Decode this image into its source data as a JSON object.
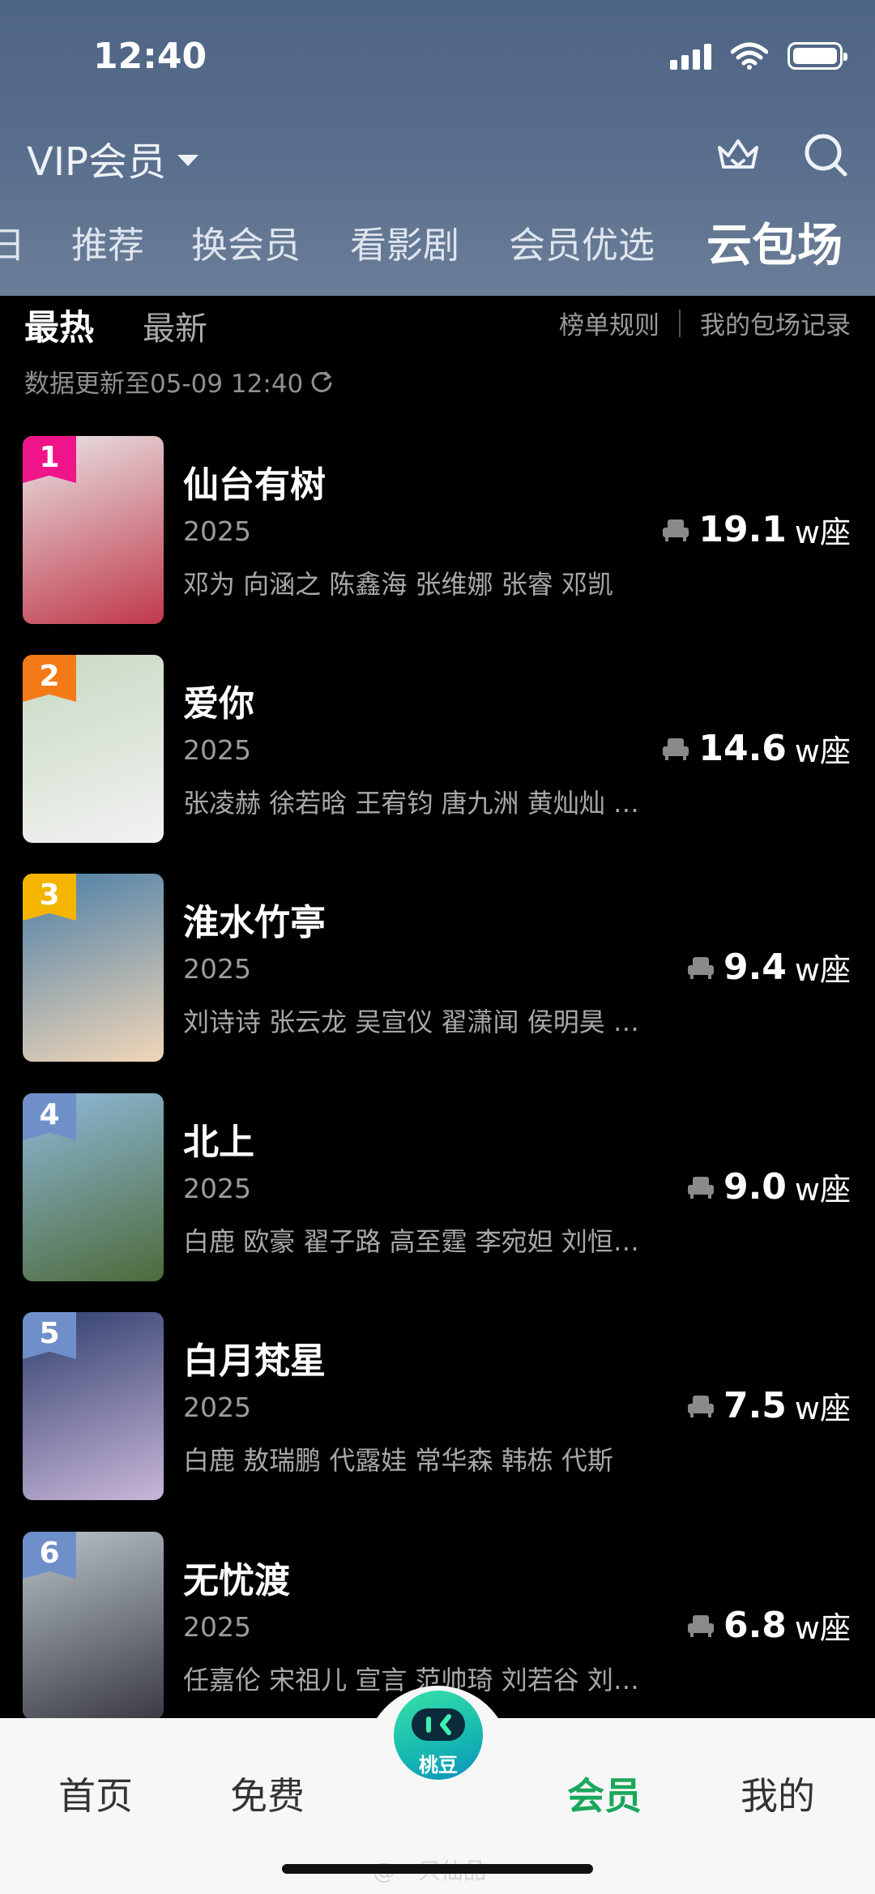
{
  "status_bar": {
    "time": "12:40"
  },
  "header": {
    "vip_selector": "VIP会员",
    "tabs": [
      {
        "label": "日",
        "active": false
      },
      {
        "label": "推荐",
        "active": false
      },
      {
        "label": "换会员",
        "active": false
      },
      {
        "label": "看影剧",
        "active": false
      },
      {
        "label": "会员优选",
        "active": false
      },
      {
        "label": "云包场",
        "active": true
      }
    ]
  },
  "sub_tabs": [
    {
      "label": "最热",
      "active": true
    },
    {
      "label": "最新",
      "active": false
    }
  ],
  "links": {
    "rules": "榜单规则",
    "my_records": "我的包场记录"
  },
  "update_text": "数据更新至05-09 12:40",
  "items": [
    {
      "rank": "1",
      "rank_color": "#f0148a",
      "title": "仙台有树",
      "year": "2025",
      "cast": "邓为 向涵之 陈鑫海 张维娜 张睿 邓凯",
      "seats_value": "19.1",
      "seats_unit": "w座",
      "poster_colors": [
        "#e8e4e6",
        "#c0394a"
      ]
    },
    {
      "rank": "2",
      "rank_color": "#f47a18",
      "title": "爱你",
      "year": "2025",
      "cast": "张凌赫 徐若晗 王宥钧 唐九洲 黄灿灿 …",
      "seats_value": "14.6",
      "seats_unit": "w座",
      "poster_colors": [
        "#c8d9c2",
        "#f2f2f2"
      ]
    },
    {
      "rank": "3",
      "rank_color": "#f5b400",
      "title": "淮水竹亭",
      "year": "2025",
      "cast": "刘诗诗 张云龙 吴宣仪 翟潇闻 侯明昊 …",
      "seats_value": "9.4",
      "seats_unit": "w座",
      "poster_colors": [
        "#4b7fa6",
        "#f1d6b8"
      ]
    },
    {
      "rank": "4",
      "rank_color": "#6f8fc9",
      "title": "北上",
      "year": "2025",
      "cast": "白鹿 欧豪 翟子路 高至霆 李宛妲 刘恒…",
      "seats_value": "9.0",
      "seats_unit": "w座",
      "poster_colors": [
        "#8fb9d9",
        "#4d6b3b"
      ]
    },
    {
      "rank": "5",
      "rank_color": "#6f8fc9",
      "title": "白月梵星",
      "year": "2025",
      "cast": "白鹿 敖瑞鹏 代露娃 常华森 韩栋 代斯",
      "seats_value": "7.5",
      "seats_unit": "w座",
      "poster_colors": [
        "#2f3e6e",
        "#c9b7d8"
      ]
    },
    {
      "rank": "6",
      "rank_color": "#6f8fc9",
      "title": "无忧渡",
      "year": "2025",
      "cast": "任嘉伦 宋祖儿 宣言 范帅琦 刘若谷 刘…",
      "seats_value": "6.8",
      "seats_unit": "w座",
      "poster_colors": [
        "#b9c3c9",
        "#3a3a44"
      ]
    }
  ],
  "bottom_nav": {
    "items": [
      {
        "label": "首页",
        "active": false
      },
      {
        "label": "免费",
        "active": false
      },
      {
        "label": "会员",
        "active": true
      },
      {
        "label": "我的",
        "active": false
      }
    ],
    "center_label": "桃豆"
  },
  "watermark": "@一只仙品"
}
